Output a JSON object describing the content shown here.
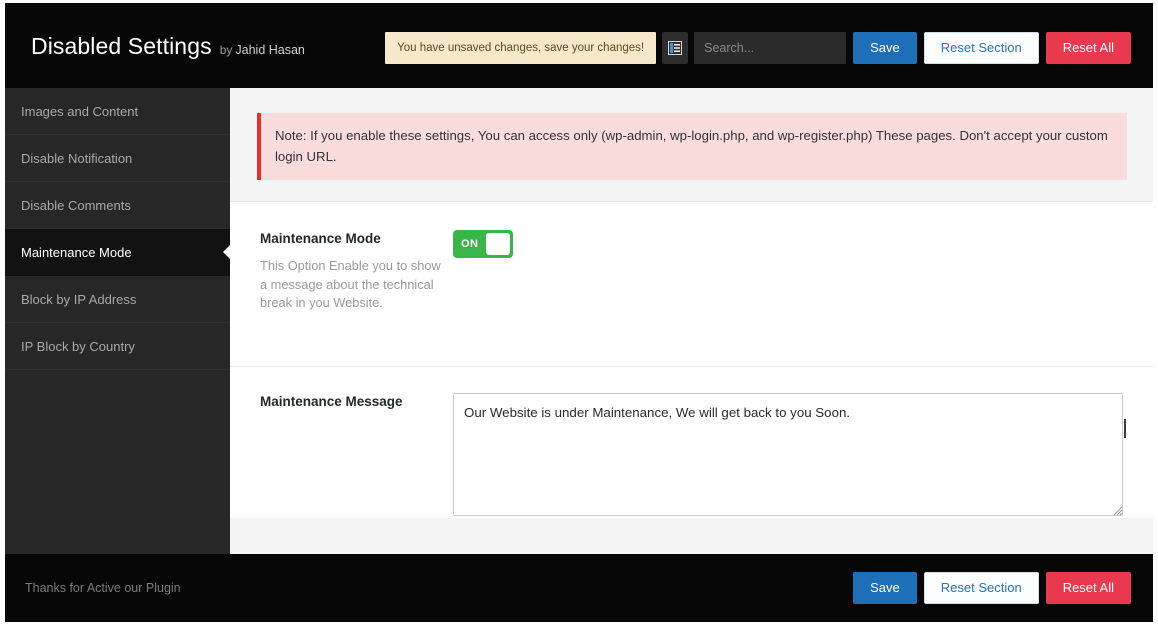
{
  "header": {
    "brand_title": "Disabled Settings",
    "brand_by": "by",
    "brand_author": "Jahid Hasan",
    "unsaved_notice": "You have unsaved changes, save your changes!",
    "expand_icon": "expand-collapse-icon",
    "search_placeholder": "Search...",
    "search_value": "",
    "save_label": "Save",
    "reset_section_label": "Reset Section",
    "reset_all_label": "Reset All"
  },
  "sidebar": {
    "items": [
      {
        "label": "Images and Content",
        "active": false
      },
      {
        "label": "Disable Notification",
        "active": false
      },
      {
        "label": "Disable Comments",
        "active": false
      },
      {
        "label": "Maintenance Mode",
        "active": true
      },
      {
        "label": "Block by IP Address",
        "active": false
      },
      {
        "label": "IP Block by Country",
        "active": false
      }
    ]
  },
  "content": {
    "note": "Note: If you enable these settings, You can access only (wp-admin, wp-login.php, and wp-register.php) These pages. Don't accept your custom login URL.",
    "fields": [
      {
        "title": "Maintenance Mode",
        "description": "This Option Enable you to show a message about the technical break in you Website.",
        "control": "toggle",
        "toggle_state": "ON"
      },
      {
        "title": "Maintenance Message",
        "description": "",
        "control": "textarea",
        "value": "Our Website is under Maintenance, We will get back to you Soon."
      }
    ]
  },
  "footer": {
    "note": "Thanks for Active our Plugin",
    "save_label": "Save",
    "reset_section_label": "Reset Section",
    "reset_all_label": "Reset All"
  },
  "colors": {
    "header_bg": "#070707",
    "sidebar_bg": "#272727",
    "sidebar_active_bg": "#121212",
    "accent_blue": "#1d6fb8",
    "accent_red": "#e8394f",
    "toggle_green": "#3ab54a",
    "notice_bg": "#f6e8cb",
    "note_bg": "#fadcdc",
    "note_border": "#e03131"
  }
}
